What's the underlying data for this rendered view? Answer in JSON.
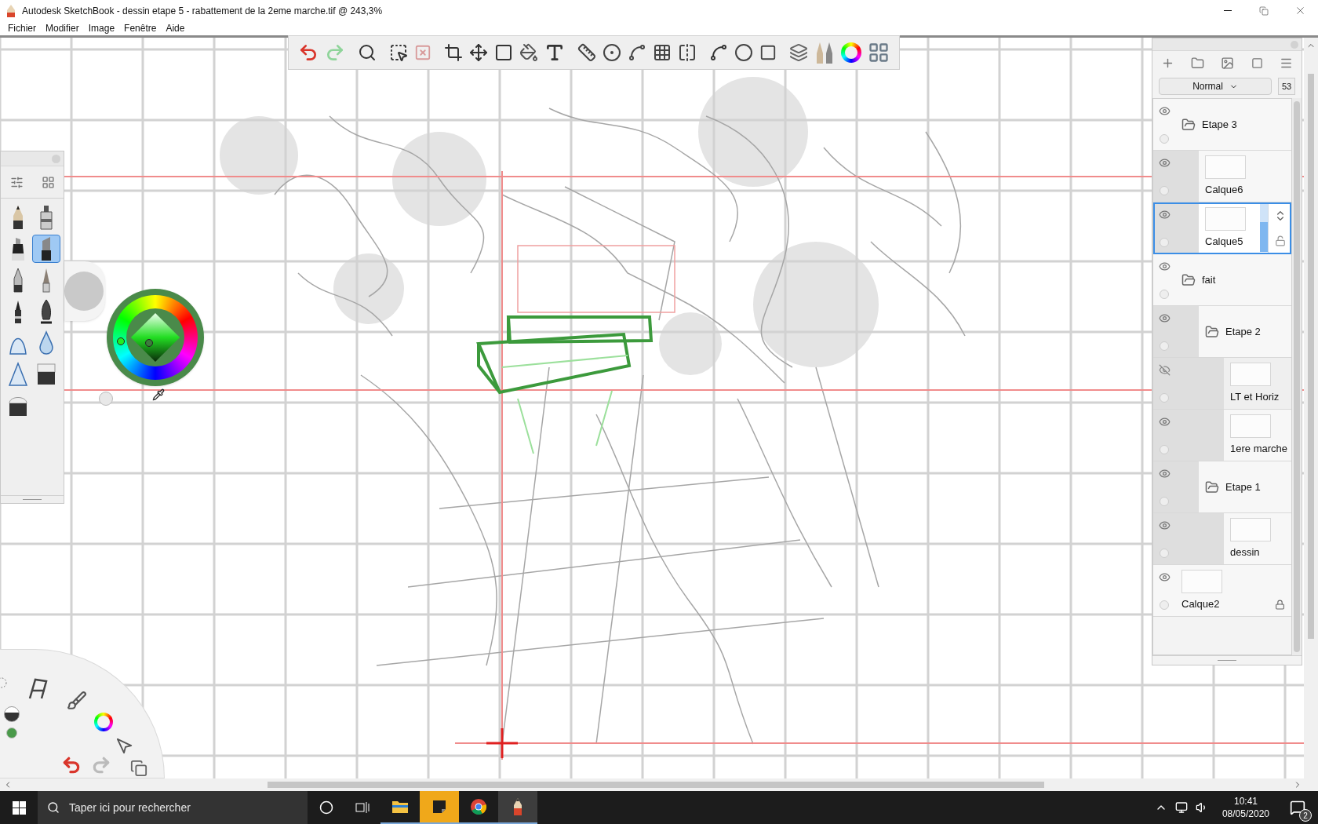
{
  "window": {
    "title": "Autodesk SketchBook - dessin etape 5 - rabattement de la 2eme marche.tif @ 243,3%"
  },
  "menu": [
    "Fichier",
    "Modifier",
    "Image",
    "Fenêtre",
    "Aide"
  ],
  "brushes": [
    {
      "kind": "pencil",
      "selected": false
    },
    {
      "kind": "airbrush",
      "selected": false
    },
    {
      "kind": "marker",
      "selected": false
    },
    {
      "kind": "chisel",
      "selected": true
    },
    {
      "kind": "ballpoint",
      "selected": false
    },
    {
      "kind": "paintbrush",
      "selected": false
    },
    {
      "kind": "inkpen",
      "selected": false
    },
    {
      "kind": "nib",
      "selected": false
    },
    {
      "kind": "smudge",
      "selected": false
    },
    {
      "kind": "blur",
      "selected": false
    },
    {
      "kind": "sharpen",
      "selected": false
    },
    {
      "kind": "eraser",
      "selected": false
    },
    {
      "kind": "softeraser",
      "selected": false
    }
  ],
  "layers_panel": {
    "blend_mode": "Normal",
    "opacity": "53",
    "layers": [
      {
        "kind": "group",
        "name": "Etape 3",
        "visible": true,
        "selected": false,
        "children": [
          {
            "kind": "layer",
            "name": "Calque6",
            "visible": true,
            "selected": false
          },
          {
            "kind": "layer",
            "name": "Calque5",
            "visible": true,
            "selected": true,
            "locked": false,
            "level": 0.62
          }
        ]
      },
      {
        "kind": "group",
        "name": "fait",
        "visible": true,
        "selected": false,
        "children": [
          {
            "kind": "group",
            "name": "Etape 2",
            "visible": true,
            "selected": false,
            "children": [
              {
                "kind": "layer",
                "name": "LT et Horiz",
                "visible": false,
                "selected": false
              },
              {
                "kind": "layer",
                "name": "1ere marche",
                "visible": true,
                "selected": false
              }
            ]
          },
          {
            "kind": "group",
            "name": "Etape 1",
            "visible": true,
            "selected": false,
            "children": [
              {
                "kind": "layer",
                "name": "dessin",
                "visible": true,
                "selected": false
              }
            ]
          }
        ]
      },
      {
        "kind": "layer",
        "name": "Calque2",
        "visible": true,
        "selected": false,
        "locked": true
      }
    ]
  },
  "taskbar": {
    "search_placeholder": "Taper ici pour rechercher",
    "apps": [
      {
        "kind": "explorer",
        "selected": false
      },
      {
        "kind": "notes",
        "selected": false
      },
      {
        "kind": "chrome",
        "selected": false
      },
      {
        "kind": "sketchbook",
        "selected": true
      }
    ],
    "time": "10:41",
    "date": "08/05/2020",
    "notifications": "2"
  }
}
